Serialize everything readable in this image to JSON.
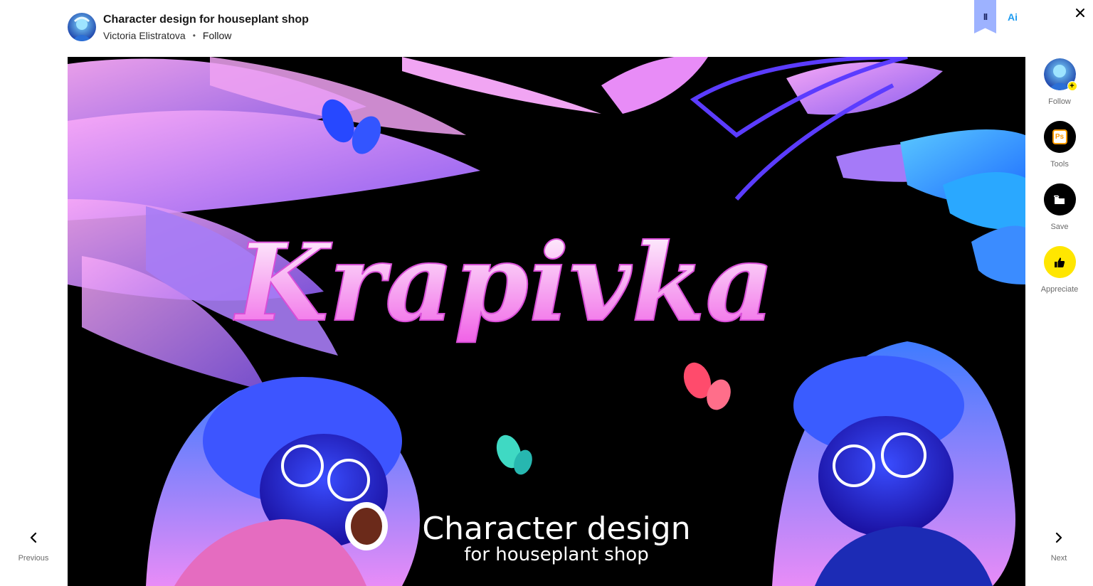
{
  "header": {
    "title": "Character design for houseplant shop",
    "author": "Victoria Elistratova",
    "separator": "•",
    "follow_label": "Follow"
  },
  "top_tools": {
    "ps_badge": "II",
    "ai_label": "Ai",
    "close_icon": "close-icon"
  },
  "artwork": {
    "headline": "Krapivka",
    "caption_line1": "Character design",
    "caption_line2": "for houseplant shop"
  },
  "sidebar": {
    "items": [
      {
        "label": "Follow",
        "icon": "avatar-plus-icon"
      },
      {
        "label": "Tools",
        "icon": "photoshop-icon",
        "badge": "Ps"
      },
      {
        "label": "Save",
        "icon": "folder-icon"
      },
      {
        "label": "Appreciate",
        "icon": "thumbs-up-icon"
      }
    ]
  },
  "nav": {
    "previous_label": "Previous",
    "next_label": "Next"
  },
  "colors": {
    "ribbon": "#9db2ff",
    "ai_blue": "#1f9cf0",
    "appreciate_yellow": "#ffe600",
    "artwork_bg": "#000000",
    "headline_pink": "#f4a4f0"
  }
}
